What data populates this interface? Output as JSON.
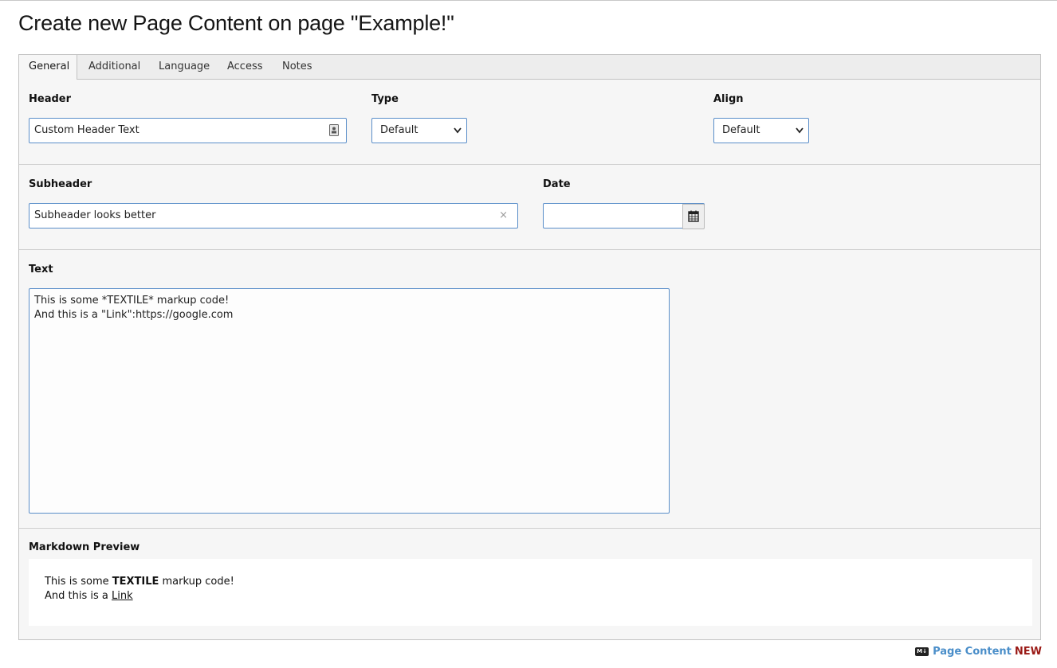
{
  "page": {
    "title": "Create new Page Content on page \"Example!\""
  },
  "tabs": [
    {
      "label": "General",
      "active": true
    },
    {
      "label": "Additional"
    },
    {
      "label": "Language"
    },
    {
      "label": "Access"
    },
    {
      "label": "Notes"
    }
  ],
  "header_field": {
    "label": "Header",
    "value": "Custom Header Text"
  },
  "type_field": {
    "label": "Type",
    "value": "Default"
  },
  "align_field": {
    "label": "Align",
    "value": "Default"
  },
  "subheader_field": {
    "label": "Subheader",
    "value": "Subheader looks better",
    "clear_glyph": "×"
  },
  "date_field": {
    "label": "Date",
    "value": ""
  },
  "text_field": {
    "label": "Text",
    "line1": "This is some *TEXTILE* markup code!",
    "line2": "And this is a \"Link\":https://google.com"
  },
  "preview": {
    "label": "Markdown Preview",
    "line1_pre": "This is some ",
    "line1_bold": "TEXTILE",
    "line1_post": " markup code!",
    "line2_pre": "And this is a ",
    "line2_link": "Link"
  },
  "footer": {
    "icon_text": "M↓",
    "title": "Page Content",
    "status": "NEW"
  }
}
